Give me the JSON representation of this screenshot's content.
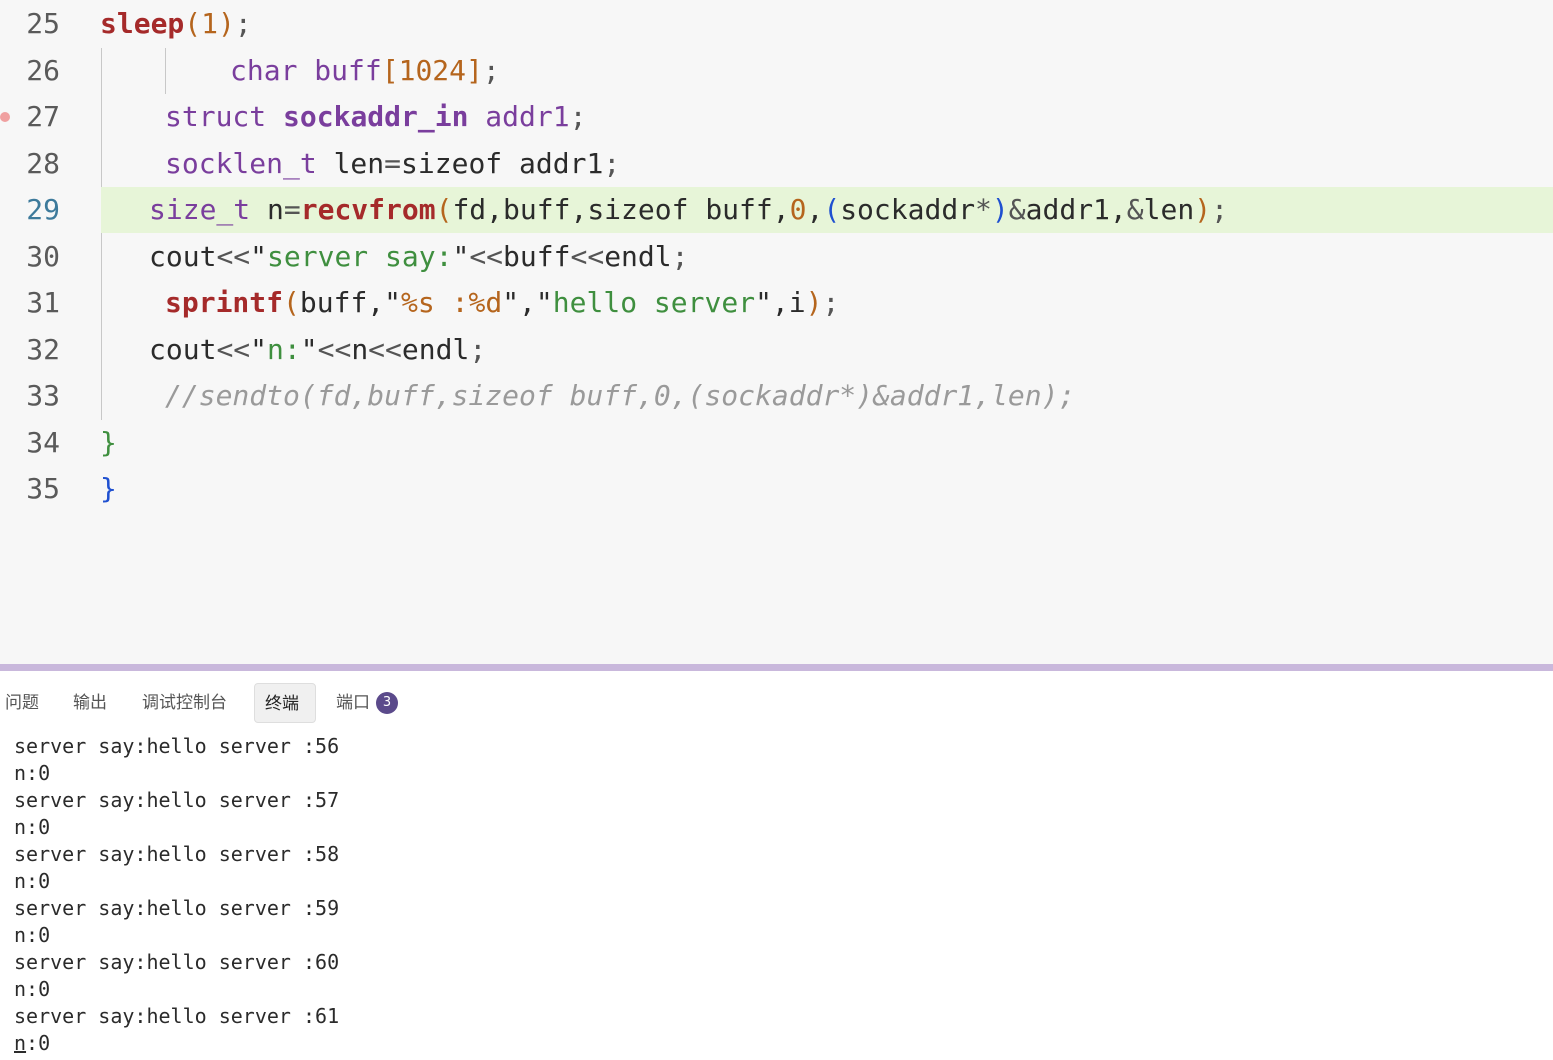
{
  "editor": {
    "current_line": "29",
    "breakpoint_line": "27",
    "lines": [
      {
        "num": "25",
        "segments": [
          {
            "t": "sleep",
            "c": "fn"
          },
          {
            "t": "(",
            "c": "br1"
          },
          {
            "t": "1",
            "c": "num"
          },
          {
            "t": ")",
            "c": "br1"
          },
          {
            "t": ";",
            "c": "op"
          }
        ]
      },
      {
        "num": "26",
        "segments": [
          {
            "t": "char",
            "c": "kw"
          },
          {
            "t": " buff",
            "c": "kw"
          },
          {
            "t": "[",
            "c": "br1"
          },
          {
            "t": "1024",
            "c": "num"
          },
          {
            "t": "]",
            "c": "br1"
          },
          {
            "t": ";",
            "c": "op"
          }
        ]
      },
      {
        "num": "27",
        "segments": [
          {
            "t": "struct",
            "c": "kw"
          },
          {
            "t": " ",
            "c": ""
          },
          {
            "t": "sockaddr_in",
            "c": "kwb"
          },
          {
            "t": " addr1",
            "c": "kw"
          },
          {
            "t": ";",
            "c": "op"
          }
        ]
      },
      {
        "num": "28",
        "segments": [
          {
            "t": "socklen_t",
            "c": "kw"
          },
          {
            "t": " len",
            "c": ""
          },
          {
            "t": "=",
            "c": "op"
          },
          {
            "t": "sizeof",
            "c": ""
          },
          {
            "t": " addr1",
            "c": ""
          },
          {
            "t": ";",
            "c": "op"
          }
        ]
      },
      {
        "num": "29",
        "segments": [
          {
            "t": "size_t",
            "c": "kw"
          },
          {
            "t": " n",
            "c": ""
          },
          {
            "t": "=",
            "c": "op"
          },
          {
            "t": "recvfrom",
            "c": "fn"
          },
          {
            "t": "(",
            "c": "br1"
          },
          {
            "t": "fd,buff,sizeof buff,",
            "c": ""
          },
          {
            "t": "0",
            "c": "num"
          },
          {
            "t": ",",
            "c": ""
          },
          {
            "t": "(",
            "c": "br2"
          },
          {
            "t": "sockaddr",
            "c": ""
          },
          {
            "t": "*",
            "c": "op"
          },
          {
            "t": ")",
            "c": "br2"
          },
          {
            "t": "&",
            "c": "op"
          },
          {
            "t": "addr1,",
            "c": ""
          },
          {
            "t": "&",
            "c": "op"
          },
          {
            "t": "len",
            "c": ""
          },
          {
            "t": ")",
            "c": "br1"
          },
          {
            "t": ";",
            "c": "op"
          }
        ]
      },
      {
        "num": "30",
        "segments": [
          {
            "t": "cout",
            "c": ""
          },
          {
            "t": "<<",
            "c": "op"
          },
          {
            "t": "\"",
            "c": ""
          },
          {
            "t": "server say:",
            "c": "str"
          },
          {
            "t": "\"",
            "c": ""
          },
          {
            "t": "<<",
            "c": "op"
          },
          {
            "t": "buff",
            "c": ""
          },
          {
            "t": "<<",
            "c": "op"
          },
          {
            "t": "endl",
            "c": ""
          },
          {
            "t": ";",
            "c": "op"
          }
        ]
      },
      {
        "num": "31",
        "segments": [
          {
            "t": "sprintf",
            "c": "fn"
          },
          {
            "t": "(",
            "c": "br1"
          },
          {
            "t": "buff,",
            "c": ""
          },
          {
            "t": "\"",
            "c": ""
          },
          {
            "t": "%s :%d",
            "c": "num"
          },
          {
            "t": "\"",
            "c": ""
          },
          {
            "t": ",",
            "c": ""
          },
          {
            "t": "\"",
            "c": ""
          },
          {
            "t": "hello server",
            "c": "str"
          },
          {
            "t": "\"",
            "c": ""
          },
          {
            "t": ",i",
            "c": ""
          },
          {
            "t": ")",
            "c": "br1"
          },
          {
            "t": ";",
            "c": "op"
          }
        ]
      },
      {
        "num": "32",
        "segments": [
          {
            "t": "cout",
            "c": ""
          },
          {
            "t": "<<",
            "c": "op"
          },
          {
            "t": "\"",
            "c": ""
          },
          {
            "t": "n:",
            "c": "str"
          },
          {
            "t": "\"",
            "c": ""
          },
          {
            "t": "<<",
            "c": "op"
          },
          {
            "t": "n",
            "c": ""
          },
          {
            "t": "<<",
            "c": "op"
          },
          {
            "t": "endl",
            "c": ""
          },
          {
            "t": ";",
            "c": "op"
          }
        ]
      },
      {
        "num": "33",
        "segments": [
          {
            "t": "//sendto(fd,buff,sizeof buff,0,(sockaddr*)&addr1,len);",
            "c": "cm"
          }
        ]
      },
      {
        "num": "34",
        "segments": [
          {
            "t": "}",
            "c": "brg"
          }
        ]
      },
      {
        "num": "35",
        "segments": [
          {
            "t": "}",
            "c": "br2"
          }
        ]
      }
    ]
  },
  "panel": {
    "tabs": [
      {
        "label": "问题"
      },
      {
        "label": "输出"
      },
      {
        "label": "调试控制台"
      },
      {
        "label": "终端"
      },
      {
        "label": "端口"
      }
    ],
    "active_tab": "终端",
    "ports_badge": "3"
  },
  "terminal": {
    "lines": [
      "server say:hello server :56",
      "n:0",
      "server say:hello server :57",
      "n:0",
      "server say:hello server :58",
      "n:0",
      "server say:hello server :59",
      "n:0",
      "server say:hello server :60",
      "n:0",
      "server say:hello server :61",
      "n:0"
    ]
  }
}
